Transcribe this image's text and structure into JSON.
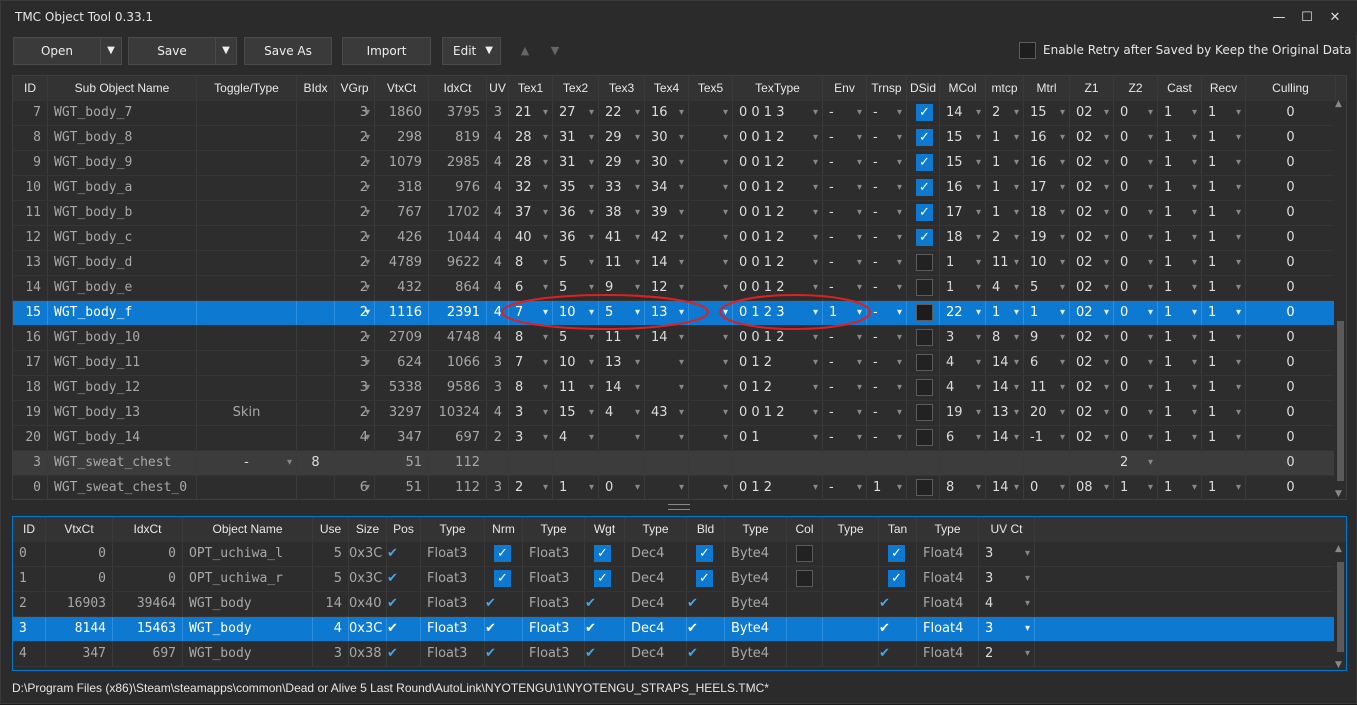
{
  "window": {
    "title": "TMC Object Tool 0.33.1",
    "minimize": "—",
    "maximize": "☐",
    "close": "✕"
  },
  "toolbar": {
    "open": "Open",
    "save": "Save",
    "save_as": "Save As",
    "import": "Import",
    "edit": "Edit",
    "up_arrow": "▲",
    "down_arrow": "▼",
    "retry_label": "Enable Retry after Saved by Keep the Original Data"
  },
  "sub_objects": {
    "headers": [
      "ID",
      "Sub Object Name",
      "Toggle/Type",
      "BIdx",
      "VGrp",
      "VtxCt",
      "IdxCt",
      "UV",
      "Tex1",
      "Tex2",
      "Tex3",
      "Tex4",
      "Tex5",
      "TexType",
      "Env",
      "Trnsp",
      "DSid",
      "MCol",
      "mtcp",
      "Mtrl",
      "Z1",
      "Z2",
      "Cast",
      "Recv",
      "Culling"
    ],
    "rows": [
      {
        "id": "7",
        "name": "WGT_body_7",
        "toggle": "",
        "bidx": "",
        "vgrp": "3",
        "vtx": "1860",
        "idx": "3795",
        "uv": "3",
        "t1": "21",
        "t2": "27",
        "t3": "22",
        "t4": "16",
        "t5": "",
        "textype": "0 0 1 3",
        "env": "-",
        "trnsp": "-",
        "dsid": "on",
        "mcol": "14",
        "mtcp": "2",
        "mtrl": "15",
        "z1": "02",
        "z2": "0",
        "cast": "1",
        "recv": "1",
        "cull": "0"
      },
      {
        "id": "8",
        "name": "WGT_body_8",
        "toggle": "",
        "bidx": "",
        "vgrp": "2",
        "vtx": "298",
        "idx": "819",
        "uv": "4",
        "t1": "28",
        "t2": "31",
        "t3": "29",
        "t4": "30",
        "t5": "",
        "textype": "0 0 1 2",
        "env": "-",
        "trnsp": "-",
        "dsid": "on",
        "mcol": "15",
        "mtcp": "1",
        "mtrl": "16",
        "z1": "02",
        "z2": "0",
        "cast": "1",
        "recv": "1",
        "cull": "0"
      },
      {
        "id": "9",
        "name": "WGT_body_9",
        "toggle": "",
        "bidx": "",
        "vgrp": "2",
        "vtx": "1079",
        "idx": "2985",
        "uv": "4",
        "t1": "28",
        "t2": "31",
        "t3": "29",
        "t4": "30",
        "t5": "",
        "textype": "0 0 1 2",
        "env": "-",
        "trnsp": "-",
        "dsid": "on",
        "mcol": "15",
        "mtcp": "1",
        "mtrl": "16",
        "z1": "02",
        "z2": "0",
        "cast": "1",
        "recv": "1",
        "cull": "0"
      },
      {
        "id": "10",
        "name": "WGT_body_a",
        "toggle": "",
        "bidx": "",
        "vgrp": "2",
        "vtx": "318",
        "idx": "976",
        "uv": "4",
        "t1": "32",
        "t2": "35",
        "t3": "33",
        "t4": "34",
        "t5": "",
        "textype": "0 0 1 2",
        "env": "-",
        "trnsp": "-",
        "dsid": "on",
        "mcol": "16",
        "mtcp": "1",
        "mtrl": "17",
        "z1": "02",
        "z2": "0",
        "cast": "1",
        "recv": "1",
        "cull": "0"
      },
      {
        "id": "11",
        "name": "WGT_body_b",
        "toggle": "",
        "bidx": "",
        "vgrp": "2",
        "vtx": "767",
        "idx": "1702",
        "uv": "4",
        "t1": "37",
        "t2": "36",
        "t3": "38",
        "t4": "39",
        "t5": "",
        "textype": "0 0 1 2",
        "env": "-",
        "trnsp": "-",
        "dsid": "on",
        "mcol": "17",
        "mtcp": "1",
        "mtrl": "18",
        "z1": "02",
        "z2": "0",
        "cast": "1",
        "recv": "1",
        "cull": "0"
      },
      {
        "id": "12",
        "name": "WGT_body_c",
        "toggle": "",
        "bidx": "",
        "vgrp": "2",
        "vtx": "426",
        "idx": "1044",
        "uv": "4",
        "t1": "40",
        "t2": "36",
        "t3": "41",
        "t4": "42",
        "t5": "",
        "textype": "0 0 1 2",
        "env": "-",
        "trnsp": "-",
        "dsid": "on",
        "mcol": "18",
        "mtcp": "2",
        "mtrl": "19",
        "z1": "02",
        "z2": "0",
        "cast": "1",
        "recv": "1",
        "cull": "0"
      },
      {
        "id": "13",
        "name": "WGT_body_d",
        "toggle": "",
        "bidx": "",
        "vgrp": "2",
        "vtx": "4789",
        "idx": "9622",
        "uv": "4",
        "t1": "8",
        "t2": "5",
        "t3": "11",
        "t4": "14",
        "t5": "",
        "textype": "0 0 1 2",
        "env": "-",
        "trnsp": "-",
        "dsid": "off",
        "mcol": "1",
        "mtcp": "11",
        "mtrl": "10",
        "z1": "02",
        "z2": "0",
        "cast": "1",
        "recv": "1",
        "cull": "0"
      },
      {
        "id": "14",
        "name": "WGT_body_e",
        "toggle": "",
        "bidx": "",
        "vgrp": "2",
        "vtx": "432",
        "idx": "864",
        "uv": "4",
        "t1": "6",
        "t2": "5",
        "t3": "9",
        "t4": "12",
        "t5": "",
        "textype": "0 0 1 2",
        "env": "-",
        "trnsp": "-",
        "dsid": "off",
        "mcol": "1",
        "mtcp": "4",
        "mtrl": "5",
        "z1": "02",
        "z2": "0",
        "cast": "1",
        "recv": "1",
        "cull": "0"
      },
      {
        "id": "15",
        "name": "WGT_body_f",
        "toggle": "",
        "bidx": "",
        "vgrp": "2",
        "vtx": "1116",
        "idx": "2391",
        "uv": "4",
        "t1": "7",
        "t2": "10",
        "t3": "5",
        "t4": "13",
        "t5": "",
        "textype": "0 1 2 3",
        "env": "1",
        "trnsp": "-",
        "dsid": "dark",
        "mcol": "22",
        "mtcp": "1",
        "mtrl": "1",
        "z1": "02",
        "z2": "0",
        "cast": "1",
        "recv": "1",
        "cull": "0",
        "selected": true
      },
      {
        "id": "16",
        "name": "WGT_body_10",
        "toggle": "",
        "bidx": "",
        "vgrp": "2",
        "vtx": "2709",
        "idx": "4748",
        "uv": "4",
        "t1": "8",
        "t2": "5",
        "t3": "11",
        "t4": "14",
        "t5": "",
        "textype": "0 0 1 2",
        "env": "-",
        "trnsp": "-",
        "dsid": "off",
        "mcol": "3",
        "mtcp": "8",
        "mtrl": "9",
        "z1": "02",
        "z2": "0",
        "cast": "1",
        "recv": "1",
        "cull": "0"
      },
      {
        "id": "17",
        "name": "WGT_body_11",
        "toggle": "",
        "bidx": "",
        "vgrp": "3",
        "vtx": "624",
        "idx": "1066",
        "uv": "3",
        "t1": "7",
        "t2": "10",
        "t3": "13",
        "t4": "",
        "t5": "",
        "textype": "0 1 2",
        "env": "-",
        "trnsp": "-",
        "dsid": "off",
        "mcol": "4",
        "mtcp": "14",
        "mtrl": "6",
        "z1": "02",
        "z2": "0",
        "cast": "1",
        "recv": "1",
        "cull": "0"
      },
      {
        "id": "18",
        "name": "WGT_body_12",
        "toggle": "",
        "bidx": "",
        "vgrp": "3",
        "vtx": "5338",
        "idx": "9586",
        "uv": "3",
        "t1": "8",
        "t2": "11",
        "t3": "14",
        "t4": "",
        "t5": "",
        "textype": "0 1 2",
        "env": "-",
        "trnsp": "-",
        "dsid": "off",
        "mcol": "4",
        "mtcp": "14",
        "mtrl": "11",
        "z1": "02",
        "z2": "0",
        "cast": "1",
        "recv": "1",
        "cull": "0"
      },
      {
        "id": "19",
        "name": "WGT_body_13",
        "toggle": "Skin",
        "bidx": "",
        "vgrp": "2",
        "vtx": "3297",
        "idx": "10324",
        "uv": "4",
        "t1": "3",
        "t2": "15",
        "t3": "4",
        "t4": "43",
        "t5": "",
        "textype": "0 0 1 2",
        "env": "-",
        "trnsp": "-",
        "dsid": "off",
        "mcol": "19",
        "mtcp": "13",
        "mtrl": "20",
        "z1": "02",
        "z2": "0",
        "cast": "1",
        "recv": "1",
        "cull": "0"
      },
      {
        "id": "20",
        "name": "WGT_body_14",
        "toggle": "",
        "bidx": "",
        "vgrp": "4",
        "vtx": "347",
        "idx": "697",
        "uv": "2",
        "t1": "3",
        "t2": "4",
        "t3": "",
        "t4": "",
        "t5": "",
        "textype": "0 1",
        "env": "-",
        "trnsp": "-",
        "dsid": "off",
        "mcol": "6",
        "mtcp": "14",
        "mtrl": "-1",
        "z1": "02",
        "z2": "0",
        "cast": "1",
        "recv": "1",
        "cull": "0"
      },
      {
        "id": "3",
        "name": "WGT_sweat_chest",
        "toggle": "-",
        "bidx": "8",
        "vgrp": "",
        "vtx": "51",
        "idx": "112",
        "uv": "",
        "t1": "",
        "t2": "",
        "t3": "",
        "t4": "",
        "t5": "",
        "textype": "",
        "env": "",
        "trnsp": "",
        "dsid": "none",
        "mcol": "",
        "mtcp": "",
        "mtrl": "",
        "z1": "",
        "z2": "2",
        "cast": "",
        "recv": "",
        "cull": "0",
        "group": true
      },
      {
        "id": "0",
        "name": "WGT_sweat_chest_0",
        "toggle": "",
        "bidx": "",
        "vgrp": "6",
        "vtx": "51",
        "idx": "112",
        "uv": "3",
        "t1": "2",
        "t2": "1",
        "t3": "0",
        "t4": "",
        "t5": "",
        "textype": "0 1 2",
        "env": "-",
        "trnsp": "1",
        "dsid": "off",
        "mcol": "8",
        "mtcp": "14",
        "mtrl": "0",
        "z1": "08",
        "z2": "1",
        "cast": "1",
        "recv": "1",
        "cull": "0"
      }
    ]
  },
  "objects": {
    "headers": [
      "ID",
      "VtxCt",
      "IdxCt",
      "Object Name",
      "Use",
      "Size",
      "Pos",
      "Type",
      "Nrm",
      "Type",
      "Wgt",
      "Type",
      "Bld",
      "Type",
      "Col",
      "Type",
      "Tan",
      "Type",
      "UV Ct"
    ],
    "rows": [
      {
        "id": "0",
        "vtx": "0",
        "idx": "0",
        "name": "OPT_uchiwa_l",
        "use": "5",
        "size": "0x3C",
        "pos": "✔",
        "ptype": "Float3",
        "nrm": "box",
        "ntype": "Float3",
        "wgt": "box",
        "wtype": "Dec4",
        "bld": "box",
        "btype": "Byte4",
        "col": "empty",
        "ctype": "",
        "tan": "box",
        "ttype": "Float4",
        "uvct": "3"
      },
      {
        "id": "1",
        "vtx": "0",
        "idx": "0",
        "name": "OPT_uchiwa_r",
        "use": "5",
        "size": "0x3C",
        "pos": "✔",
        "ptype": "Float3",
        "nrm": "box",
        "ntype": "Float3",
        "wgt": "box",
        "wtype": "Dec4",
        "bld": "box",
        "btype": "Byte4",
        "col": "empty",
        "ctype": "",
        "tan": "box",
        "ttype": "Float4",
        "uvct": "3"
      },
      {
        "id": "2",
        "vtx": "16903",
        "idx": "39464",
        "name": "WGT_body",
        "use": "14",
        "size": "0x40",
        "pos": "✔",
        "ptype": "Float3",
        "nrm": "✔",
        "ntype": "Float3",
        "wgt": "✔",
        "wtype": "Dec4",
        "bld": "✔",
        "btype": "Byte4",
        "col": "",
        "ctype": "",
        "tan": "✔",
        "ttype": "Float4",
        "uvct": "4"
      },
      {
        "id": "3",
        "vtx": "8144",
        "idx": "15463",
        "name": "WGT_body",
        "use": "4",
        "size": "0x3C",
        "pos": "✔",
        "ptype": "Float3",
        "nrm": "✔",
        "ntype": "Float3",
        "wgt": "✔",
        "wtype": "Dec4",
        "bld": "✔",
        "btype": "Byte4",
        "col": "",
        "ctype": "",
        "tan": "✔",
        "ttype": "Float4",
        "uvct": "3",
        "selected": true
      },
      {
        "id": "4",
        "vtx": "347",
        "idx": "697",
        "name": "WGT_body",
        "use": "3",
        "size": "0x38",
        "pos": "✔",
        "ptype": "Float3",
        "nrm": "✔",
        "ntype": "Float3",
        "wgt": "✔",
        "wtype": "Dec4",
        "bld": "✔",
        "btype": "Byte4",
        "col": "",
        "ctype": "",
        "tan": "✔",
        "ttype": "Float4",
        "uvct": "2"
      }
    ]
  },
  "status": {
    "path": "D:\\Program Files (x86)\\Steam\\steamapps\\common\\Dead or Alive 5 Last Round\\AutoLink\\NYOTENGU\\1\\NYOTENGU_STRAPS_HEELS.TMC*"
  },
  "colors": {
    "accent": "#0e79d1",
    "annotation": "#e02020"
  }
}
